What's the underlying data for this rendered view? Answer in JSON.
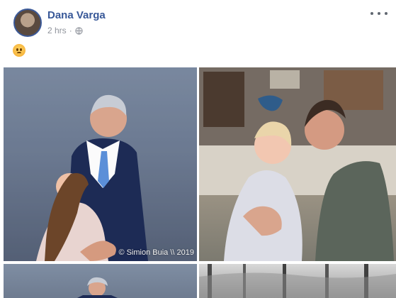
{
  "post": {
    "author": "Dana Varga",
    "time": "2 hrs",
    "privacy_icon": "globe-icon",
    "reaction_emoji": "sad-face-emoji"
  },
  "photos": {
    "watermark": "© Simion Buia \\\\ 2019"
  },
  "colors": {
    "author_link": "#385898",
    "meta_text": "#90949c"
  }
}
